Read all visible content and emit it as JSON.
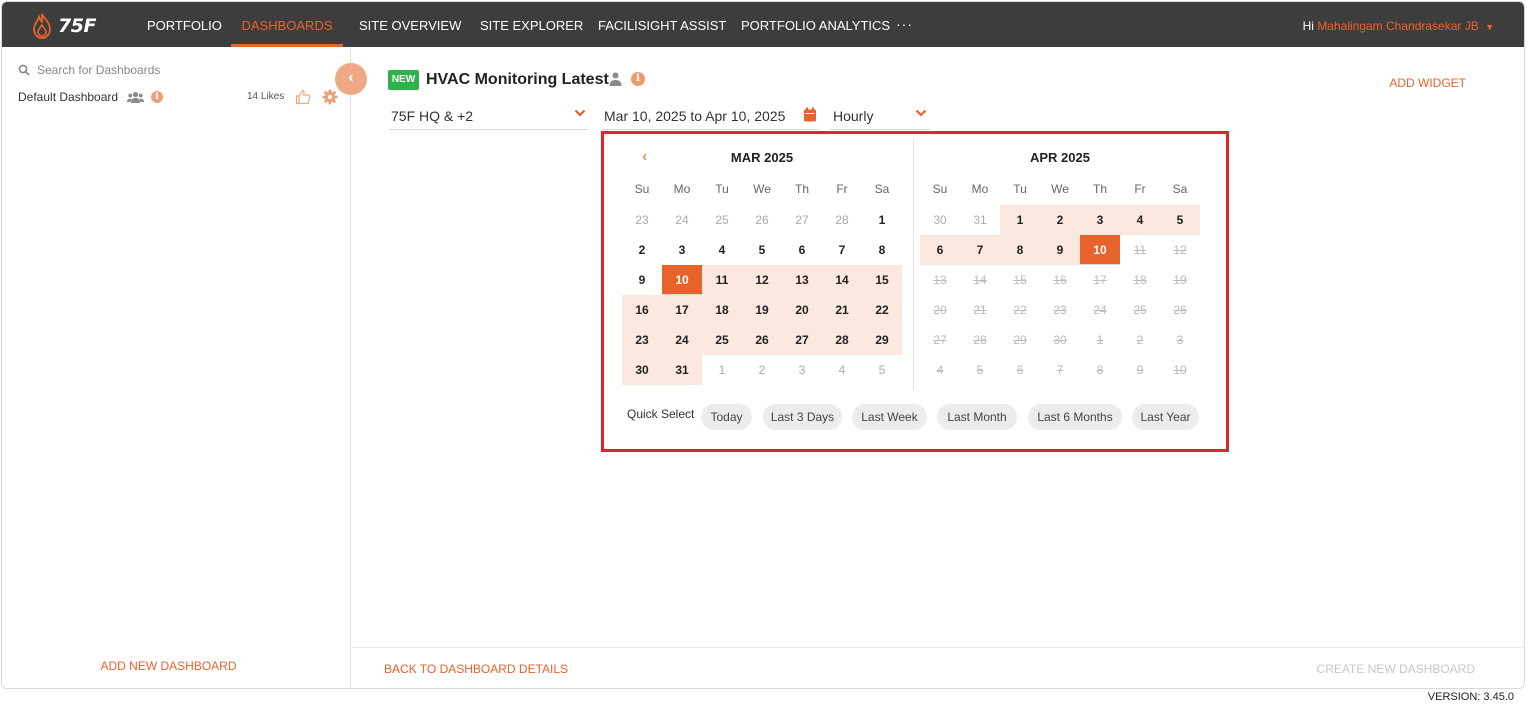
{
  "brand": {
    "logo_text": "75F",
    "accent": "#e8622c"
  },
  "nav": {
    "items": [
      "PORTFOLIO",
      "DASHBOARDS",
      "SITE OVERVIEW",
      "SITE EXPLORER",
      "FACILISIGHT ASSIST",
      "PORTFOLIO ANALYTICS"
    ],
    "active": "DASHBOARDS",
    "more": "···",
    "greeting": "Hi",
    "user_name": "Mahalingam Chandrasekar JB"
  },
  "sidebar": {
    "search_placeholder": "Search for Dashboards",
    "dashboard_name": "Default Dashboard",
    "likes": "14 Likes",
    "add_new": "ADD NEW DASHBOARD"
  },
  "header": {
    "badge": "NEW",
    "title": "HVAC Monitoring Latest",
    "add_widget": "ADD WIDGET"
  },
  "filters": {
    "site": "75F HQ & +2",
    "date_range": "Mar 10, 2025 to Apr 10, 2025",
    "interval": "Hourly"
  },
  "calendar": {
    "weekdays": [
      "Su",
      "Mo",
      "Tu",
      "We",
      "Th",
      "Fr",
      "Sa"
    ],
    "months": [
      {
        "title": "MAR 2025",
        "days": [
          [
            "23",
            "muted"
          ],
          [
            "24",
            "muted"
          ],
          [
            "25",
            "muted"
          ],
          [
            "26",
            "muted"
          ],
          [
            "27",
            "muted"
          ],
          [
            "28",
            "muted"
          ],
          [
            "1",
            ""
          ],
          [
            "2",
            ""
          ],
          [
            "3",
            ""
          ],
          [
            "4",
            ""
          ],
          [
            "5",
            ""
          ],
          [
            "6",
            ""
          ],
          [
            "7",
            ""
          ],
          [
            "8",
            ""
          ],
          [
            "9",
            ""
          ],
          [
            "10",
            "sel"
          ],
          [
            "11",
            "inrange"
          ],
          [
            "12",
            "inrange"
          ],
          [
            "13",
            "inrange"
          ],
          [
            "14",
            "inrange"
          ],
          [
            "15",
            "inrange"
          ],
          [
            "16",
            "inrange"
          ],
          [
            "17",
            "inrange"
          ],
          [
            "18",
            "inrange"
          ],
          [
            "19",
            "inrange"
          ],
          [
            "20",
            "inrange"
          ],
          [
            "21",
            "inrange"
          ],
          [
            "22",
            "inrange"
          ],
          [
            "23",
            "inrange"
          ],
          [
            "24",
            "inrange"
          ],
          [
            "25",
            "inrange"
          ],
          [
            "26",
            "inrange"
          ],
          [
            "27",
            "inrange"
          ],
          [
            "28",
            "inrange"
          ],
          [
            "29",
            "inrange"
          ],
          [
            "30",
            "inrange"
          ],
          [
            "31",
            "inrange"
          ],
          [
            "1",
            "muted"
          ],
          [
            "2",
            "muted"
          ],
          [
            "3",
            "muted"
          ],
          [
            "4",
            "muted"
          ],
          [
            "5",
            "muted"
          ]
        ]
      },
      {
        "title": "APR 2025",
        "days": [
          [
            "30",
            "muted"
          ],
          [
            "31",
            "muted"
          ],
          [
            "1",
            "inrange"
          ],
          [
            "2",
            "inrange"
          ],
          [
            "3",
            "inrange"
          ],
          [
            "4",
            "inrange"
          ],
          [
            "5",
            "inrange"
          ],
          [
            "6",
            "inrange"
          ],
          [
            "7",
            "inrange"
          ],
          [
            "8",
            "inrange"
          ],
          [
            "9",
            "inrange"
          ],
          [
            "10",
            "sel"
          ],
          [
            "11",
            "dis"
          ],
          [
            "12",
            "dis"
          ],
          [
            "13",
            "dis"
          ],
          [
            "14",
            "dis"
          ],
          [
            "15",
            "dis"
          ],
          [
            "16",
            "dis"
          ],
          [
            "17",
            "dis"
          ],
          [
            "18",
            "dis"
          ],
          [
            "19",
            "dis"
          ],
          [
            "20",
            "dis"
          ],
          [
            "21",
            "dis"
          ],
          [
            "22",
            "dis"
          ],
          [
            "23",
            "dis"
          ],
          [
            "24",
            "dis"
          ],
          [
            "25",
            "dis"
          ],
          [
            "26",
            "dis"
          ],
          [
            "27",
            "dis"
          ],
          [
            "28",
            "dis"
          ],
          [
            "29",
            "dis"
          ],
          [
            "30",
            "dis"
          ],
          [
            "1",
            "dis"
          ],
          [
            "2",
            "dis"
          ],
          [
            "3",
            "dis"
          ],
          [
            "4",
            "dis"
          ],
          [
            "5",
            "dis"
          ],
          [
            "6",
            "dis"
          ],
          [
            "7",
            "dis"
          ],
          [
            "8",
            "dis"
          ],
          [
            "9",
            "dis"
          ],
          [
            "10",
            "dis"
          ]
        ]
      }
    ],
    "quick_select_label": "Quick Select",
    "quick_options": [
      "Today",
      "Last 3 Days",
      "Last Week",
      "Last Month",
      "Last 6 Months",
      "Last Year"
    ]
  },
  "footer": {
    "back": "BACK TO DASHBOARD DETAILS",
    "create": "CREATE NEW DASHBOARD",
    "version": "VERSION: 3.45.0"
  },
  "icons": [
    "flame-logo-icon",
    "search-icon",
    "users-icon",
    "info-icon",
    "thumbs-up-icon",
    "gear-icon",
    "chevron-left-icon",
    "person-icon",
    "chevron-down-icon",
    "calendar-icon"
  ]
}
